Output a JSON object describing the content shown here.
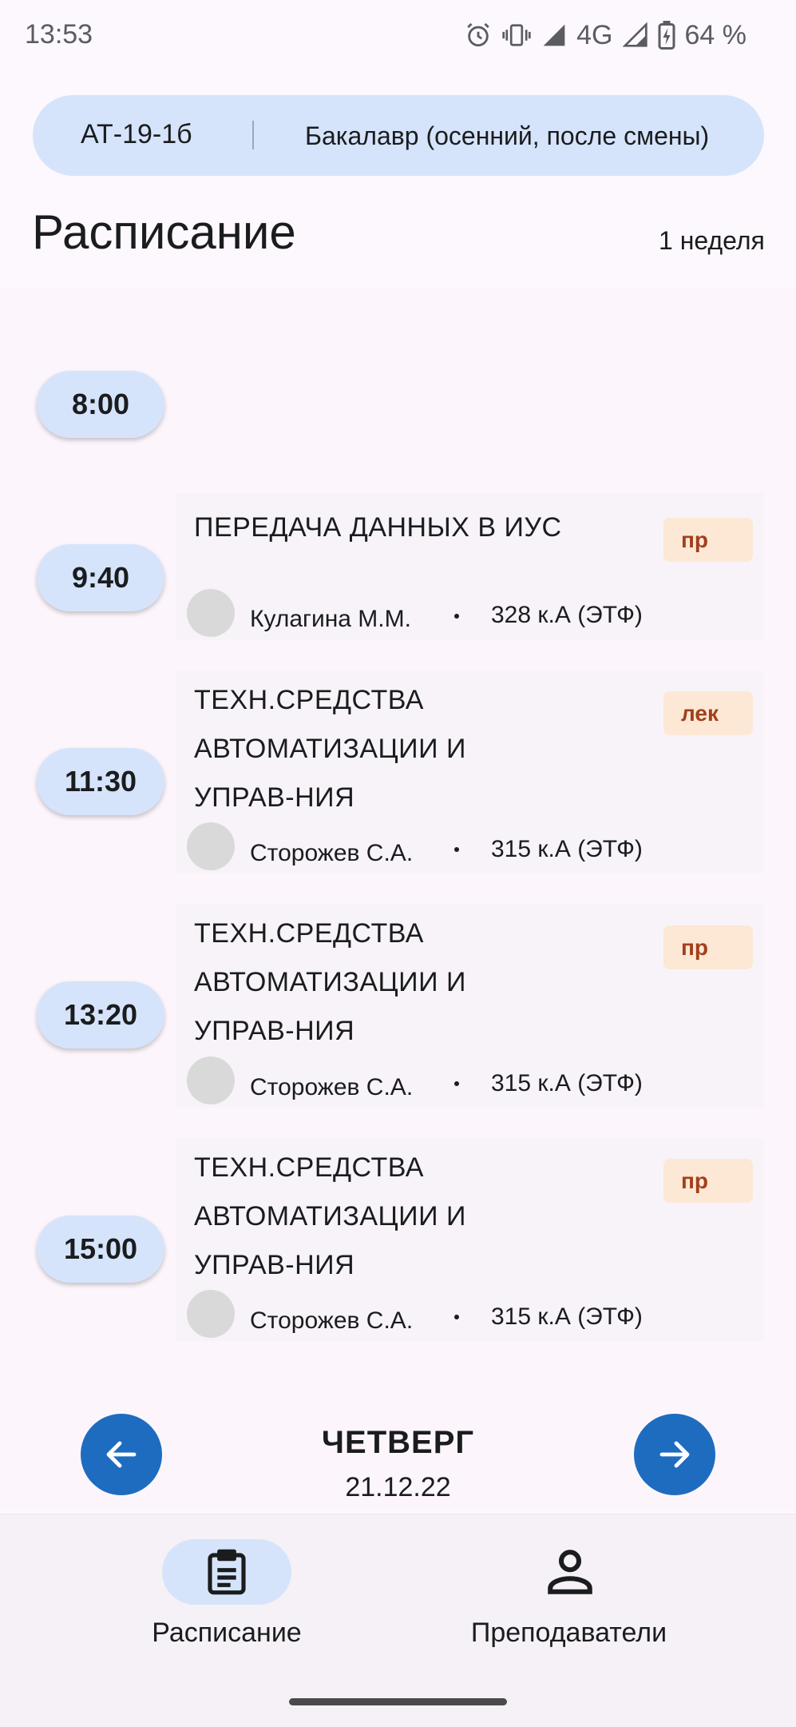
{
  "status_bar": {
    "time": "13:53",
    "network": "4G",
    "battery": "64 %",
    "icons": [
      "alarm-icon",
      "vibrate-icon",
      "signal-icon",
      "battery-charging-icon"
    ]
  },
  "group": {
    "name": "АТ-19-1б",
    "semester": "Бакалавр (осенний, после смены)"
  },
  "header": {
    "title": "Расписание",
    "week": "1 неделя"
  },
  "schedule": {
    "empty_slot_time": "8:00",
    "lessons": [
      {
        "time": "9:40",
        "subject": "ПЕРЕДАЧА ДАННЫХ В ИУС",
        "type": "пр",
        "teacher": "Кулагина М.М.",
        "room": "328 к.А (ЭТФ)"
      },
      {
        "time": "11:30",
        "subject_lines": [
          "ТЕХН.СРЕДСТВА",
          "АВТОМАТИЗАЦИИ И",
          "УПРАВ-НИЯ"
        ],
        "type": "лек",
        "teacher": "Сторожев С.А.",
        "room": "315 к.А (ЭТФ)"
      },
      {
        "time": "13:20",
        "subject_lines": [
          "ТЕХН.СРЕДСТВА",
          "АВТОМАТИЗАЦИИ И",
          "УПРАВ-НИЯ"
        ],
        "type": "пр",
        "teacher": "Сторожев С.А.",
        "room": "315 к.А (ЭТФ)"
      },
      {
        "time": "15:00",
        "subject_lines": [
          "ТЕХН.СРЕДСТВА",
          "АВТОМАТИЗАЦИИ И",
          "УПРАВ-НИЯ"
        ],
        "type": "пр",
        "teacher": "Сторожев С.А.",
        "room": "315 к.А (ЭТФ)"
      }
    ]
  },
  "day_nav": {
    "day": "ЧЕТВЕРГ",
    "date": "21.12.22",
    "prev_icon": "arrow-left-icon",
    "next_icon": "arrow-right-icon"
  },
  "bottom_nav": {
    "schedule_label": "Расписание",
    "teachers_label": "Преподаватели",
    "schedule_icon": "clipboard-icon",
    "teachers_icon": "person-icon"
  },
  "colors": {
    "accent": "#1e6cc0",
    "pill": "#d6e4fb",
    "badge_bg": "#fde8d6",
    "badge_text": "#a2401b"
  }
}
